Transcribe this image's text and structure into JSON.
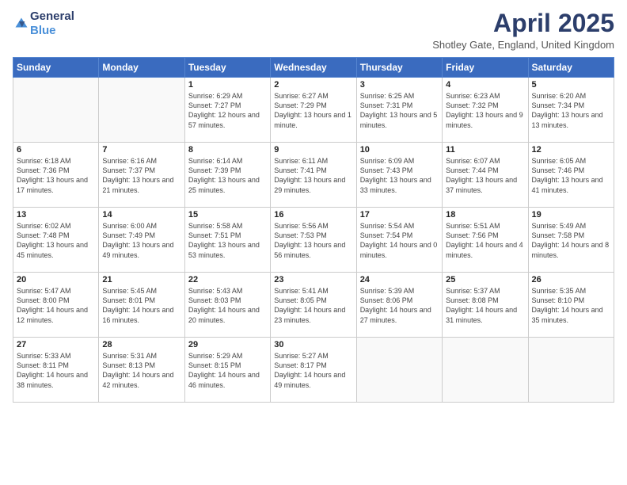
{
  "logo": {
    "general": "General",
    "blue": "Blue"
  },
  "header": {
    "title": "April 2025",
    "location": "Shotley Gate, England, United Kingdom"
  },
  "weekdays": [
    "Sunday",
    "Monday",
    "Tuesday",
    "Wednesday",
    "Thursday",
    "Friday",
    "Saturday"
  ],
  "weeks": [
    [
      {
        "day": "",
        "info": ""
      },
      {
        "day": "",
        "info": ""
      },
      {
        "day": "1",
        "info": "Sunrise: 6:29 AM\nSunset: 7:27 PM\nDaylight: 12 hours and 57 minutes."
      },
      {
        "day": "2",
        "info": "Sunrise: 6:27 AM\nSunset: 7:29 PM\nDaylight: 13 hours and 1 minute."
      },
      {
        "day": "3",
        "info": "Sunrise: 6:25 AM\nSunset: 7:31 PM\nDaylight: 13 hours and 5 minutes."
      },
      {
        "day": "4",
        "info": "Sunrise: 6:23 AM\nSunset: 7:32 PM\nDaylight: 13 hours and 9 minutes."
      },
      {
        "day": "5",
        "info": "Sunrise: 6:20 AM\nSunset: 7:34 PM\nDaylight: 13 hours and 13 minutes."
      }
    ],
    [
      {
        "day": "6",
        "info": "Sunrise: 6:18 AM\nSunset: 7:36 PM\nDaylight: 13 hours and 17 minutes."
      },
      {
        "day": "7",
        "info": "Sunrise: 6:16 AM\nSunset: 7:37 PM\nDaylight: 13 hours and 21 minutes."
      },
      {
        "day": "8",
        "info": "Sunrise: 6:14 AM\nSunset: 7:39 PM\nDaylight: 13 hours and 25 minutes."
      },
      {
        "day": "9",
        "info": "Sunrise: 6:11 AM\nSunset: 7:41 PM\nDaylight: 13 hours and 29 minutes."
      },
      {
        "day": "10",
        "info": "Sunrise: 6:09 AM\nSunset: 7:43 PM\nDaylight: 13 hours and 33 minutes."
      },
      {
        "day": "11",
        "info": "Sunrise: 6:07 AM\nSunset: 7:44 PM\nDaylight: 13 hours and 37 minutes."
      },
      {
        "day": "12",
        "info": "Sunrise: 6:05 AM\nSunset: 7:46 PM\nDaylight: 13 hours and 41 minutes."
      }
    ],
    [
      {
        "day": "13",
        "info": "Sunrise: 6:02 AM\nSunset: 7:48 PM\nDaylight: 13 hours and 45 minutes."
      },
      {
        "day": "14",
        "info": "Sunrise: 6:00 AM\nSunset: 7:49 PM\nDaylight: 13 hours and 49 minutes."
      },
      {
        "day": "15",
        "info": "Sunrise: 5:58 AM\nSunset: 7:51 PM\nDaylight: 13 hours and 53 minutes."
      },
      {
        "day": "16",
        "info": "Sunrise: 5:56 AM\nSunset: 7:53 PM\nDaylight: 13 hours and 56 minutes."
      },
      {
        "day": "17",
        "info": "Sunrise: 5:54 AM\nSunset: 7:54 PM\nDaylight: 14 hours and 0 minutes."
      },
      {
        "day": "18",
        "info": "Sunrise: 5:51 AM\nSunset: 7:56 PM\nDaylight: 14 hours and 4 minutes."
      },
      {
        "day": "19",
        "info": "Sunrise: 5:49 AM\nSunset: 7:58 PM\nDaylight: 14 hours and 8 minutes."
      }
    ],
    [
      {
        "day": "20",
        "info": "Sunrise: 5:47 AM\nSunset: 8:00 PM\nDaylight: 14 hours and 12 minutes."
      },
      {
        "day": "21",
        "info": "Sunrise: 5:45 AM\nSunset: 8:01 PM\nDaylight: 14 hours and 16 minutes."
      },
      {
        "day": "22",
        "info": "Sunrise: 5:43 AM\nSunset: 8:03 PM\nDaylight: 14 hours and 20 minutes."
      },
      {
        "day": "23",
        "info": "Sunrise: 5:41 AM\nSunset: 8:05 PM\nDaylight: 14 hours and 23 minutes."
      },
      {
        "day": "24",
        "info": "Sunrise: 5:39 AM\nSunset: 8:06 PM\nDaylight: 14 hours and 27 minutes."
      },
      {
        "day": "25",
        "info": "Sunrise: 5:37 AM\nSunset: 8:08 PM\nDaylight: 14 hours and 31 minutes."
      },
      {
        "day": "26",
        "info": "Sunrise: 5:35 AM\nSunset: 8:10 PM\nDaylight: 14 hours and 35 minutes."
      }
    ],
    [
      {
        "day": "27",
        "info": "Sunrise: 5:33 AM\nSunset: 8:11 PM\nDaylight: 14 hours and 38 minutes."
      },
      {
        "day": "28",
        "info": "Sunrise: 5:31 AM\nSunset: 8:13 PM\nDaylight: 14 hours and 42 minutes."
      },
      {
        "day": "29",
        "info": "Sunrise: 5:29 AM\nSunset: 8:15 PM\nDaylight: 14 hours and 46 minutes."
      },
      {
        "day": "30",
        "info": "Sunrise: 5:27 AM\nSunset: 8:17 PM\nDaylight: 14 hours and 49 minutes."
      },
      {
        "day": "",
        "info": ""
      },
      {
        "day": "",
        "info": ""
      },
      {
        "day": "",
        "info": ""
      }
    ]
  ]
}
